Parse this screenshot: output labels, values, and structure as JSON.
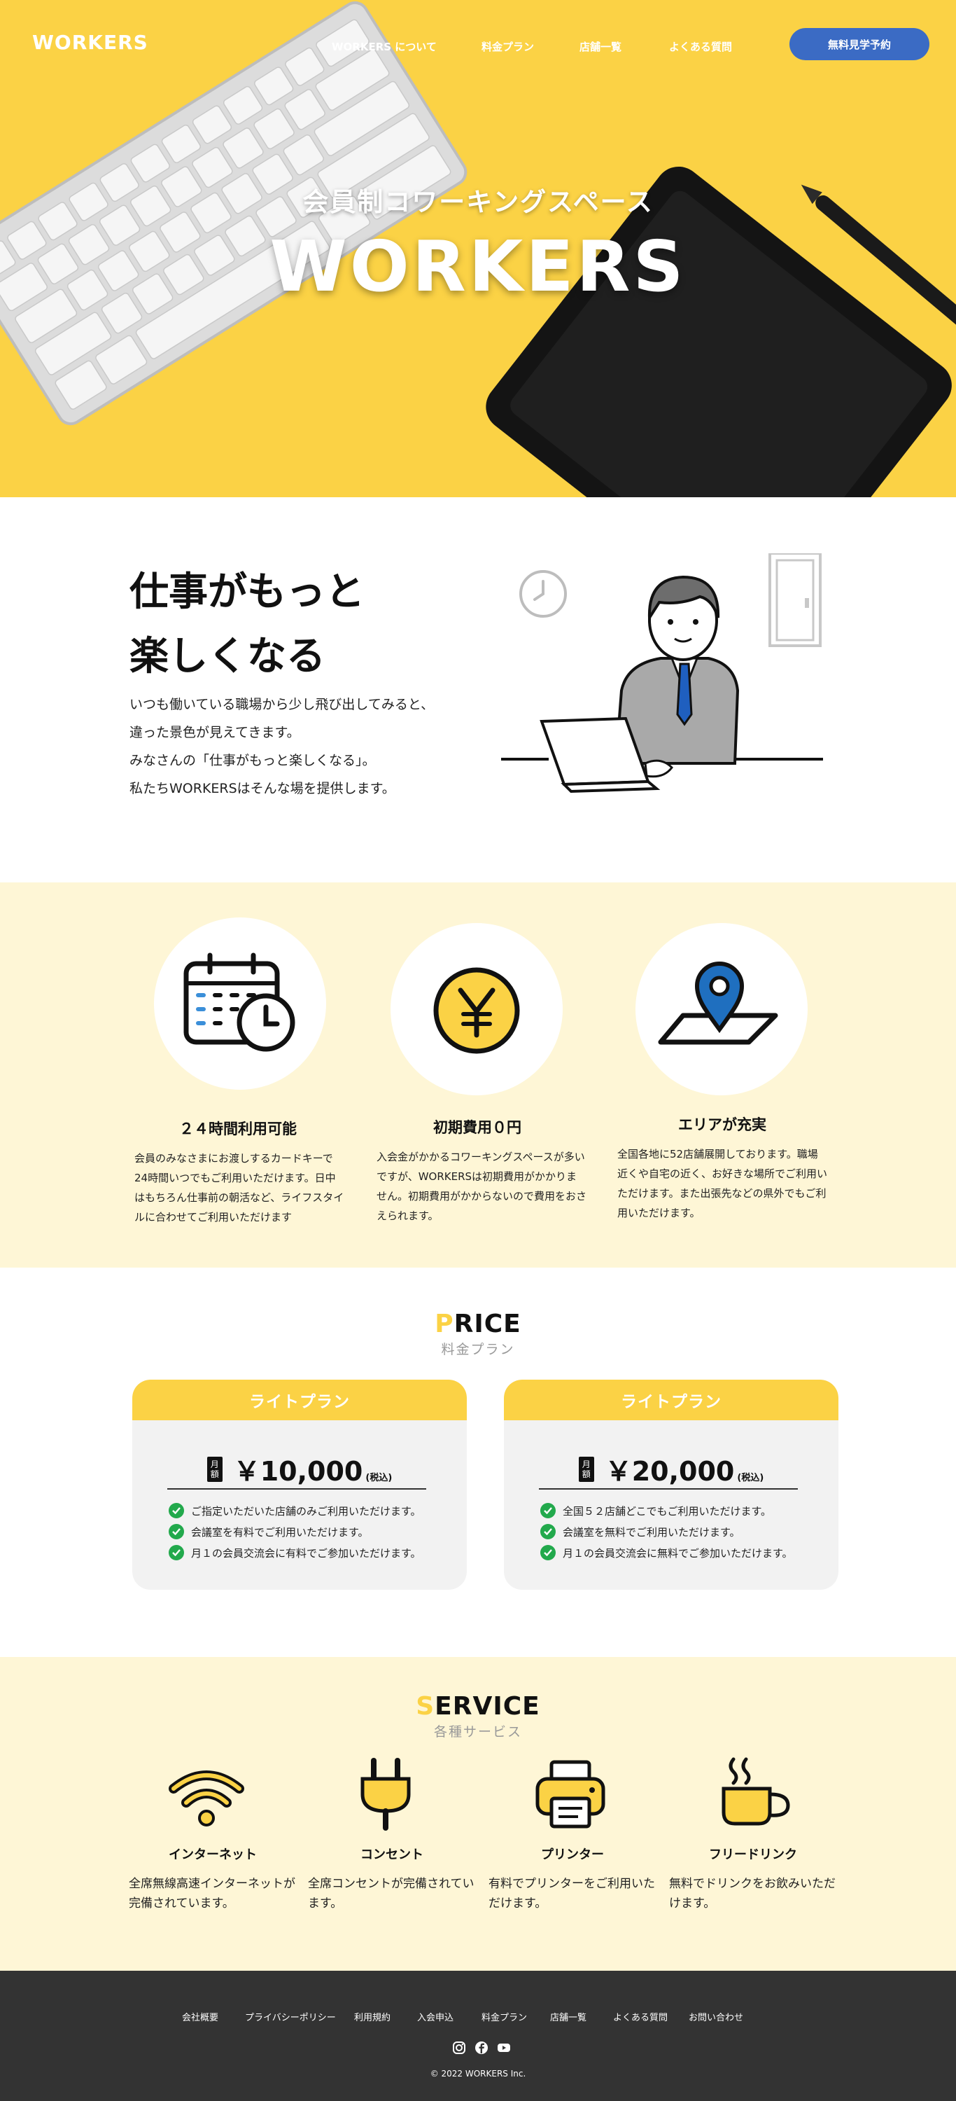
{
  "header": {
    "logo": "WORKERS",
    "nav": [
      {
        "label": "WORKERS について"
      },
      {
        "label": "料金プラン"
      },
      {
        "label": "店舗一覧"
      },
      {
        "label": "よくある質問"
      }
    ],
    "cta": "無料見学予約"
  },
  "hero": {
    "subtitle": "会員制コワーキングスペース",
    "title": "WORKERS"
  },
  "intro": {
    "title_lines": [
      "仕事がもっと",
      "楽しくなる"
    ],
    "text_lines": [
      "いつも働いている職場から少し飛び出してみると、",
      "違った景色が見えてきます。",
      "みなさんの「仕事がもっと楽しくなる」。",
      "私たちWORKERSはそんな場を提供します。"
    ]
  },
  "features": [
    {
      "icon": "calendar-clock-icon",
      "title": "２４時間利用可能",
      "text": "会員のみなさまにお渡しするカードキーで24時間いつでもご利用いただけます。日中はもちろん仕事前の朝活など、ライフスタイルに合わせてご利用いただけます"
    },
    {
      "icon": "yen-coin-icon",
      "title": "初期費用０円",
      "text": "入会金がかかるコワーキングスペースが多いですが、WORKERSは初期費用がかかりません。初期費用がかからないので費用をおさえられます。"
    },
    {
      "icon": "map-pin-icon",
      "title": "エリアが充実",
      "text": "全国各地に52店舗展開しております。職場近くや自宅の近く、お好きな場所でご利用いただけます。また出張先などの県外でもご利用いただけます。"
    }
  ],
  "price": {
    "heading_first": "P",
    "heading_rest": "RICE",
    "sub": "料金プラン",
    "plans": [
      {
        "name": "ライトプラン",
        "badge": "月額",
        "amount": "￥10,000",
        "tax": "(税込)",
        "items": [
          "ご指定いただいた店舗のみご利用いただけます。",
          "会議室を有料でご利用いただけます。",
          "月１の会員交流会に有料でご参加いただけます。"
        ]
      },
      {
        "name": "ライトプラン",
        "badge": "月額",
        "amount": "￥20,000",
        "tax": "(税込)",
        "items": [
          "全国５２店舗どこでもご利用いただけます。",
          "会議室を無料でご利用いただけます。",
          "月１の会員交流会に無料でご参加いただけます。"
        ]
      }
    ]
  },
  "service": {
    "heading_first": "S",
    "heading_rest": "ERVICE",
    "sub": "各種サービス",
    "items": [
      {
        "icon": "wifi-icon",
        "title": "インターネット",
        "text": "全席無線高速インターネットが完備されています。"
      },
      {
        "icon": "plug-icon",
        "title": "コンセント",
        "text": "全席コンセントが完備されています。"
      },
      {
        "icon": "printer-icon",
        "title": "プリンター",
        "text": "有料でプリンターをご利用いただけます。"
      },
      {
        "icon": "coffee-icon",
        "title": "フリードリンク",
        "text": "無料でドリンクをお飲みいただけます。"
      }
    ]
  },
  "footer": {
    "nav": [
      "会社概要",
      "プライバシーポリシー",
      "利用規約",
      "入会申込",
      "料金プラン",
      "店舗一覧",
      "よくある質問",
      "お問い合わせ"
    ],
    "social": [
      "instagram-icon",
      "facebook-icon",
      "youtube-icon"
    ],
    "copyright": "© 2022 WORKERS Inc."
  },
  "colors": {
    "brand_yellow": "#fbd245",
    "cta_blue": "#3b6bc4",
    "feature_bg": "#fef6d6",
    "check_green": "#22a94c",
    "footer_bg": "#333333"
  }
}
